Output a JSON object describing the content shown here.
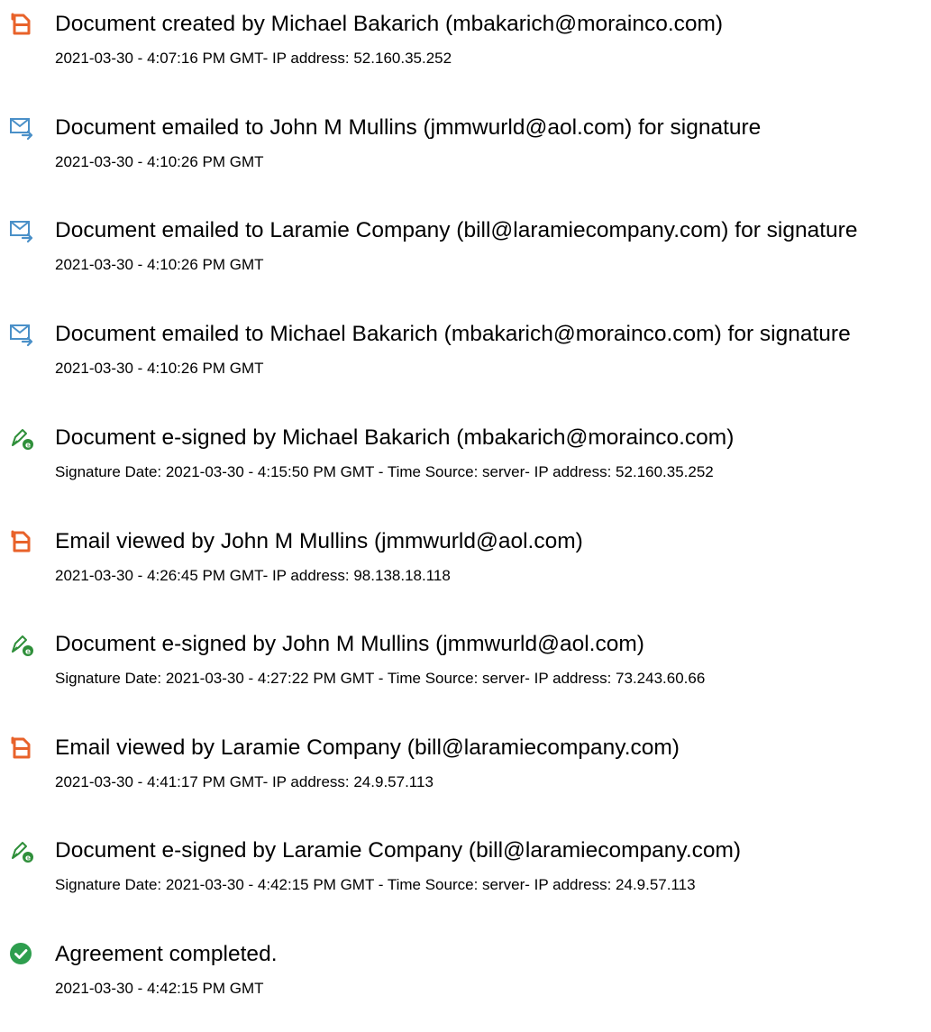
{
  "colors": {
    "document_icon": "#e8622a",
    "email_icon": "#4a90c8",
    "esign_icon": "#2f8f3a",
    "completed_icon": "#2e9e4e"
  },
  "events": [
    {
      "icon": "document-icon",
      "title": "Document created by Michael Bakarich (mbakarich@morainco.com)",
      "detail": "2021-03-30 - 4:07:16 PM GMT- IP address: 52.160.35.252"
    },
    {
      "icon": "email-icon",
      "title": "Document emailed to John M Mullins (jmmwurld@aol.com) for signature",
      "detail": "2021-03-30 - 4:10:26 PM GMT"
    },
    {
      "icon": "email-icon",
      "title": "Document emailed to Laramie Company (bill@laramiecompany.com) for signature",
      "detail": "2021-03-30 - 4:10:26 PM GMT"
    },
    {
      "icon": "email-icon",
      "title": "Document emailed to Michael Bakarich (mbakarich@morainco.com) for signature",
      "detail": "2021-03-30 - 4:10:26 PM GMT"
    },
    {
      "icon": "e-sign-icon",
      "title": "Document e-signed by Michael Bakarich (mbakarich@morainco.com)",
      "detail": "Signature Date: 2021-03-30 - 4:15:50 PM GMT - Time Source: server- IP address: 52.160.35.252"
    },
    {
      "icon": "document-icon",
      "title": "Email viewed by John M Mullins (jmmwurld@aol.com)",
      "detail": "2021-03-30 - 4:26:45 PM GMT- IP address: 98.138.18.118"
    },
    {
      "icon": "e-sign-icon",
      "title": "Document e-signed by John M Mullins (jmmwurld@aol.com)",
      "detail": "Signature Date: 2021-03-30 - 4:27:22 PM GMT - Time Source: server- IP address: 73.243.60.66"
    },
    {
      "icon": "document-icon",
      "title": "Email viewed by Laramie Company (bill@laramiecompany.com)",
      "detail": "2021-03-30 - 4:41:17 PM GMT- IP address: 24.9.57.113"
    },
    {
      "icon": "e-sign-icon",
      "title": "Document e-signed by Laramie Company (bill@laramiecompany.com)",
      "detail": "Signature Date: 2021-03-30 - 4:42:15 PM GMT - Time Source: server- IP address: 24.9.57.113"
    },
    {
      "icon": "checkmark-icon",
      "title": "Agreement completed.",
      "detail": "2021-03-30 - 4:42:15 PM GMT"
    }
  ]
}
